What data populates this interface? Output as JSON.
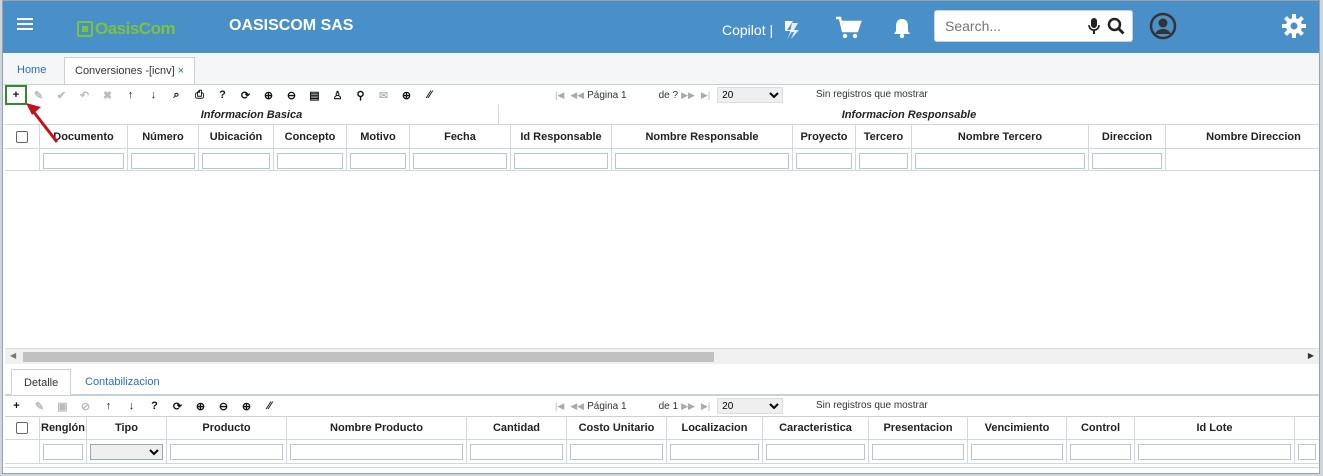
{
  "header": {
    "logo_text": "OasisCom",
    "company": "OASISCOM SAS",
    "copilot_label": "Copilot |",
    "search_placeholder": "Search..."
  },
  "tabs": {
    "home": "Home",
    "active": "Conversiones -[icnv]",
    "close_symbol": "×"
  },
  "toolbar_top": {
    "page_label": "Página 1",
    "of_label": "de ?",
    "page_size": "20",
    "no_records": "Sin registros que mostrar"
  },
  "main_grid": {
    "groups": [
      "Informacion Basica",
      "Informacion Responsable"
    ],
    "columns": [
      "Documento",
      "Número",
      "Ubicación",
      "Concepto",
      "Motivo",
      "Fecha",
      "Id Responsable",
      "Nombre Responsable",
      "Proyecto",
      "Tercero",
      "Nombre Tercero",
      "Direccion",
      "Nombre Direccion"
    ]
  },
  "subtabs": [
    "Detalle",
    "Contabilizacion"
  ],
  "toolbar_bottom": {
    "page_label": "Página 1",
    "of_label": "de 1",
    "page_size": "20",
    "no_records": "Sin registros que mostrar"
  },
  "detail_grid": {
    "columns": [
      "Renglón",
      "Tipo",
      "Producto",
      "Nombre Producto",
      "Cantidad",
      "Costo Unitario",
      "Localizacion",
      "Caracteristica",
      "Presentacion",
      "Vencimiento",
      "Control",
      "Id Lote"
    ]
  },
  "colors": {
    "topbar": "#4a90c8",
    "logo_green": "#7cc242",
    "highlight_box": "#2e8b2e",
    "arrow": "#c0141c"
  }
}
